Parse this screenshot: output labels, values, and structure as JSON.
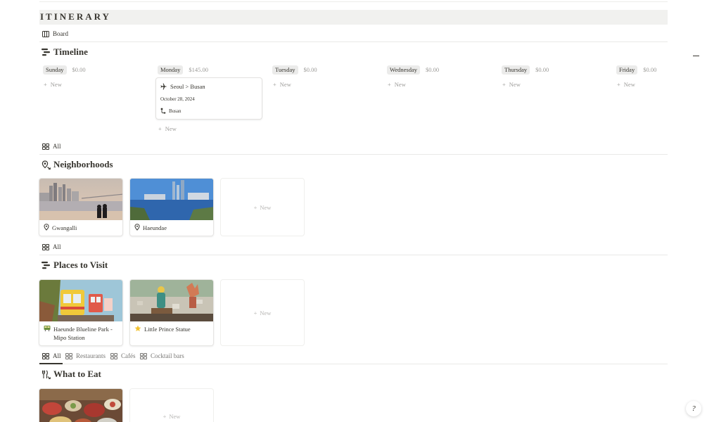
{
  "page": {
    "title": "ITINERARY"
  },
  "board_tab": {
    "label": "Board"
  },
  "timeline": {
    "title": "Timeline",
    "days": [
      {
        "name": "Sunday",
        "sum": "$0.00",
        "new": "New"
      },
      {
        "name": "Monday",
        "sum": "$145.00",
        "new": "New"
      },
      {
        "name": "Tuesday",
        "sum": "$0.00",
        "new": "New"
      },
      {
        "name": "Wednesday",
        "sum": "$0.00",
        "new": "New"
      },
      {
        "name": "Thursday",
        "sum": "$0.00",
        "new": "New"
      },
      {
        "name": "Friday",
        "sum": "$0.00",
        "new": "New"
      }
    ],
    "event": {
      "title": "Seoul > Busan",
      "date": "October 28, 2024",
      "location": "Busan"
    }
  },
  "neighborhoods": {
    "tab": "All",
    "title": "Neighborhoods",
    "cards": [
      {
        "name": "Gwangalli"
      },
      {
        "name": "Haeundae"
      }
    ],
    "new": "New"
  },
  "places": {
    "tab": "All",
    "title": "Places to Visit",
    "cards": [
      {
        "name_line1": "Haeunde Blueline Park -",
        "name_line2": "Mipo Station"
      },
      {
        "name_line1": "Little Prince Statue"
      }
    ],
    "new": "New"
  },
  "eat": {
    "tabs": [
      "All",
      "Restaurants",
      "Cafés",
      "Cocktail bars"
    ],
    "title": "What to Eat",
    "new": "New"
  },
  "icons": {
    "board": "board-view-icon",
    "timeline": "timeline-icon",
    "plane": "plane-icon",
    "route": "route-icon",
    "pin": "map-pin-icon",
    "gallery": "gallery-view-icon",
    "train": "train-emoji-icon",
    "star": "star-emoji-icon",
    "fork": "fork-knife-icon",
    "help": "help-icon"
  }
}
